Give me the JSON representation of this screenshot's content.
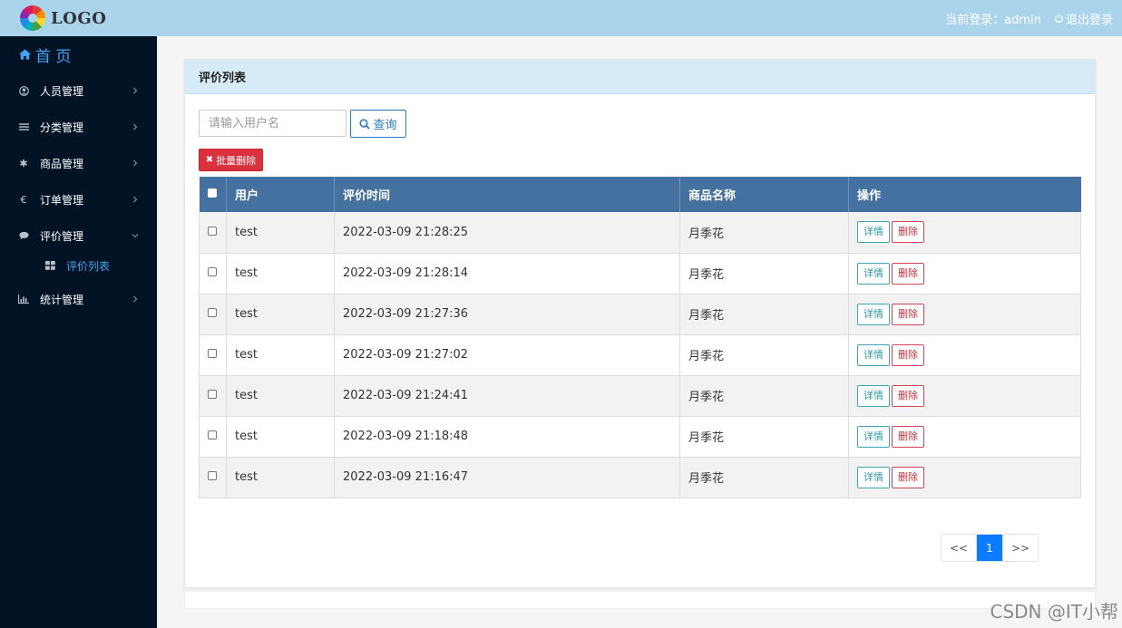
{
  "header": {
    "logo_text": "LOGO",
    "current_user_label": "当前登录：admin",
    "logout_label": "退出登录"
  },
  "sidebar": {
    "home_label": "首 页",
    "items": [
      {
        "label": "人员管理",
        "icon": "user-circle-icon"
      },
      {
        "label": "分类管理",
        "icon": "list-icon"
      },
      {
        "label": "商品管理",
        "icon": "asterisk-icon"
      },
      {
        "label": "订单管理",
        "icon": "euro-icon"
      },
      {
        "label": "评价管理",
        "icon": "comment-icon",
        "expanded": true
      },
      {
        "label": "统计管理",
        "icon": "bar-chart-icon"
      }
    ],
    "sub_item_label": "评价列表"
  },
  "panel": {
    "title": "评价列表",
    "search_placeholder": "请输入用户名",
    "search_button": "查询",
    "batch_delete": "批量删除"
  },
  "table": {
    "headers": [
      "用户",
      "评价时间",
      "商品名称",
      "操作"
    ],
    "detail_label": "详情",
    "delete_label": "删除",
    "rows": [
      {
        "user": "test",
        "time": "2022-03-09 21:28:25",
        "product": "月季花"
      },
      {
        "user": "test",
        "time": "2022-03-09 21:28:14",
        "product": "月季花"
      },
      {
        "user": "test",
        "time": "2022-03-09 21:27:36",
        "product": "月季花"
      },
      {
        "user": "test",
        "time": "2022-03-09 21:27:02",
        "product": "月季花"
      },
      {
        "user": "test",
        "time": "2022-03-09 21:24:41",
        "product": "月季花"
      },
      {
        "user": "test",
        "time": "2022-03-09 21:18:48",
        "product": "月季花"
      },
      {
        "user": "test",
        "time": "2022-03-09 21:16:47",
        "product": "月季花"
      }
    ]
  },
  "pagination": {
    "prev": "<<",
    "current": "1",
    "next": ">>"
  },
  "watermark": "CSDN @IT小帮",
  "colors": {
    "topbar": "#aad4ec",
    "sidebar": "#031326",
    "accent": "#3ea6f0",
    "table_header": "#44719f",
    "danger": "#d9313e"
  }
}
